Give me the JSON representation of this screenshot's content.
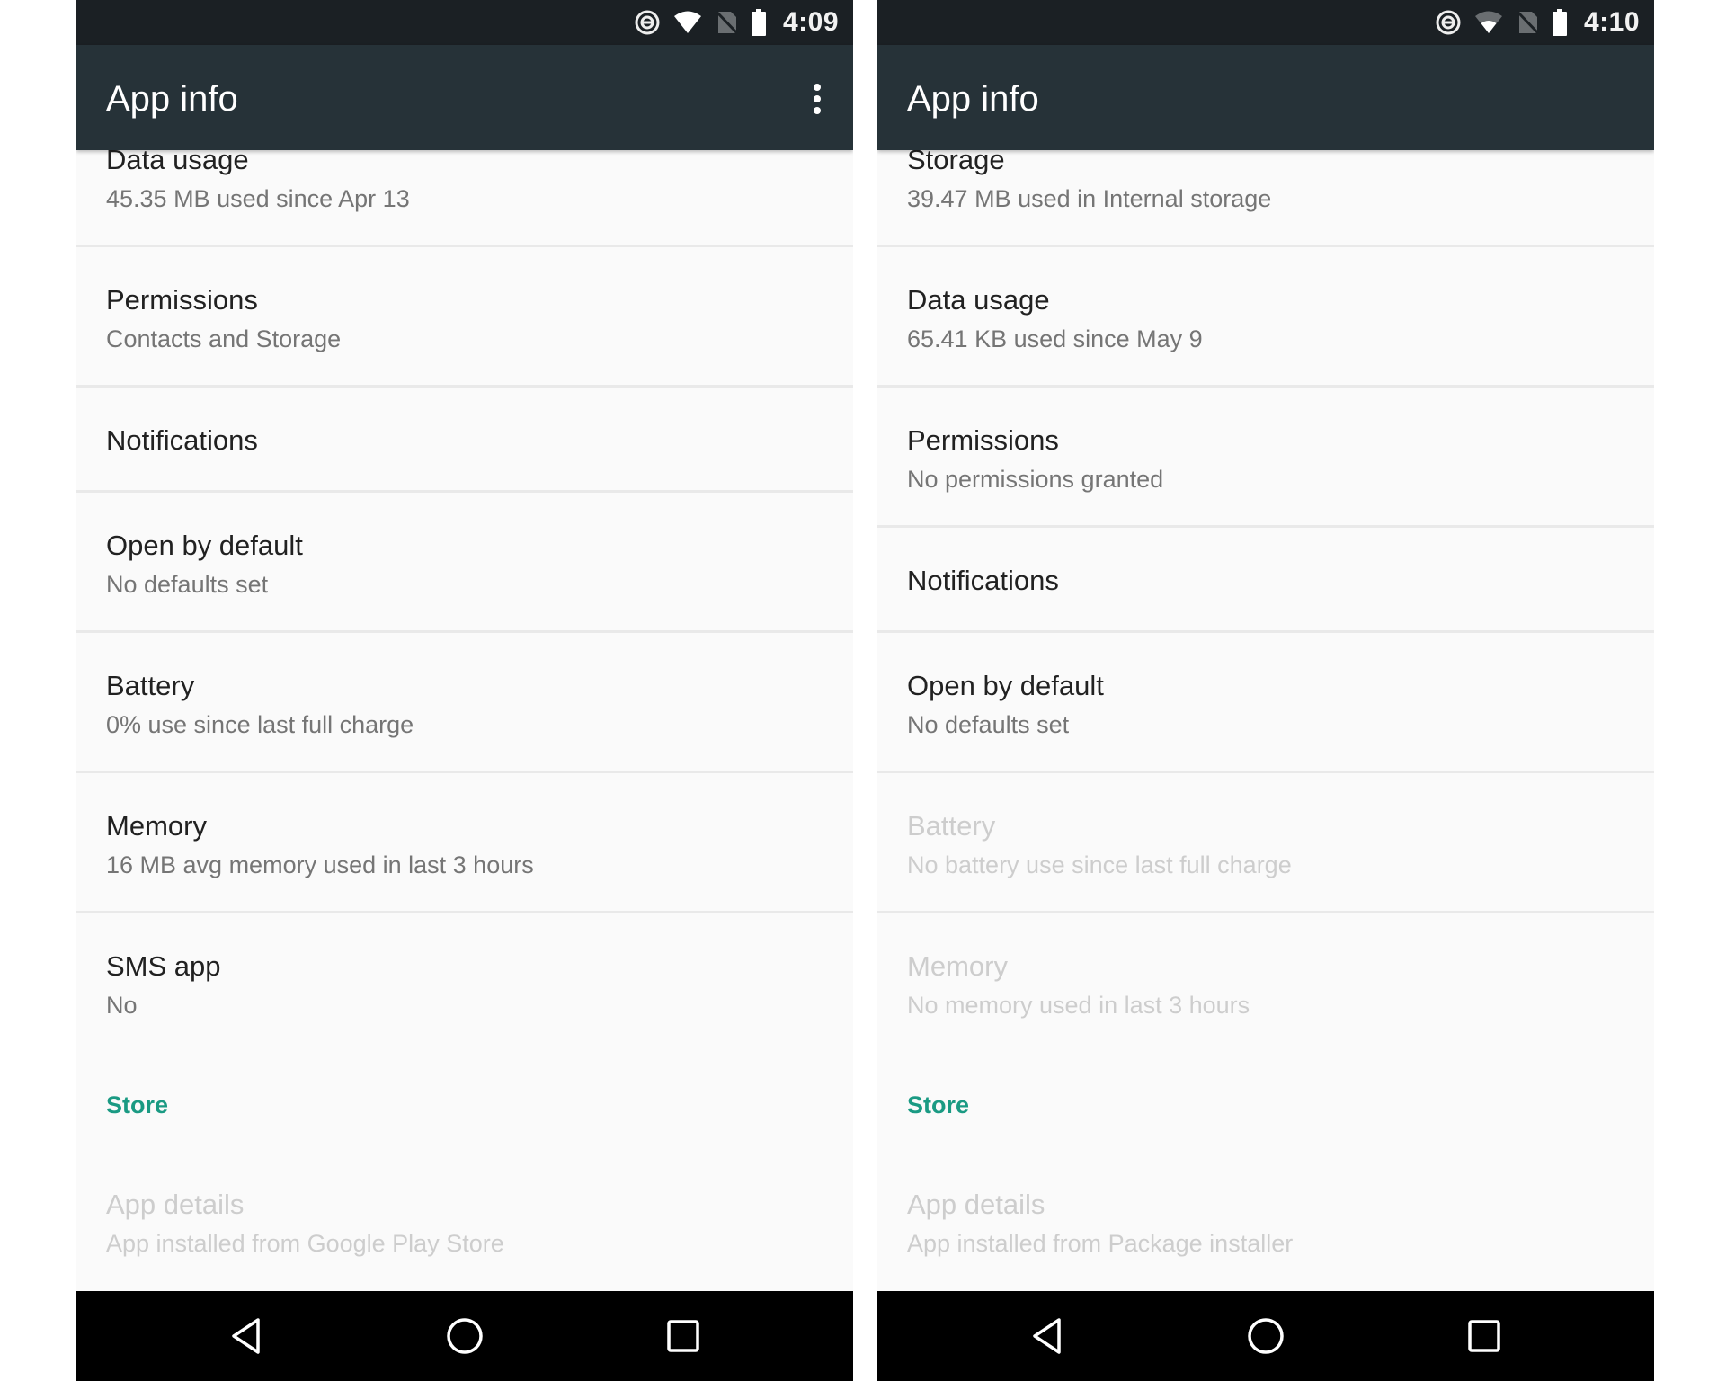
{
  "screens": [
    {
      "status_bar": {
        "time": "4:09",
        "icons": [
          "data-saver-icon",
          "wifi-icon",
          "no-sim-icon",
          "battery-icon"
        ]
      },
      "app_bar": {
        "title": "App info",
        "overflow_icon": "more-vert-icon"
      },
      "preferences": [
        {
          "title": "Data usage",
          "summary": "45.35 MB used since Apr 13",
          "enabled": true
        },
        {
          "title": "Permissions",
          "summary": "Contacts and Storage",
          "enabled": true
        },
        {
          "title": "Notifications",
          "summary": null,
          "enabled": true
        },
        {
          "title": "Open by default",
          "summary": "No defaults set",
          "enabled": true
        },
        {
          "title": "Battery",
          "summary": "0% use since last full charge",
          "enabled": true
        },
        {
          "title": "Memory",
          "summary": "16 MB avg memory used in last 3 hours",
          "enabled": true
        },
        {
          "title": "SMS app",
          "summary": "No",
          "enabled": true
        }
      ],
      "category": {
        "title": "Store"
      },
      "store_item": {
        "title": "App details",
        "summary": "App installed from Google Play Store",
        "enabled": false
      },
      "nav_bar": {
        "icons": [
          "back-icon",
          "home-icon",
          "recents-icon"
        ]
      }
    },
    {
      "status_bar": {
        "time": "4:10",
        "icons": [
          "data-saver-icon",
          "wifi-icon",
          "no-sim-icon",
          "battery-icon"
        ]
      },
      "app_bar": {
        "title": "App info"
      },
      "preferences": [
        {
          "title": "Storage",
          "summary": "39.47 MB used in Internal storage",
          "enabled": true
        },
        {
          "title": "Data usage",
          "summary": "65.41 KB used since May 9",
          "enabled": true
        },
        {
          "title": "Permissions",
          "summary": "No permissions granted",
          "enabled": true
        },
        {
          "title": "Notifications",
          "summary": null,
          "enabled": true
        },
        {
          "title": "Open by default",
          "summary": "No defaults set",
          "enabled": true
        },
        {
          "title": "Battery",
          "summary": "No battery use since last full charge",
          "enabled": false
        },
        {
          "title": "Memory",
          "summary": "No memory used in last 3 hours",
          "enabled": false
        }
      ],
      "category": {
        "title": "Store"
      },
      "store_item": {
        "title": "App details",
        "summary": "App installed from Package installer",
        "enabled": false
      },
      "nav_bar": {
        "icons": [
          "back-icon",
          "home-icon",
          "recents-icon"
        ]
      }
    }
  ],
  "colors": {
    "status_bar": "#1b2024",
    "app_bar": "#263238",
    "background": "#fafafa",
    "accent": "#1a9a83",
    "nav_bar": "#000000"
  }
}
